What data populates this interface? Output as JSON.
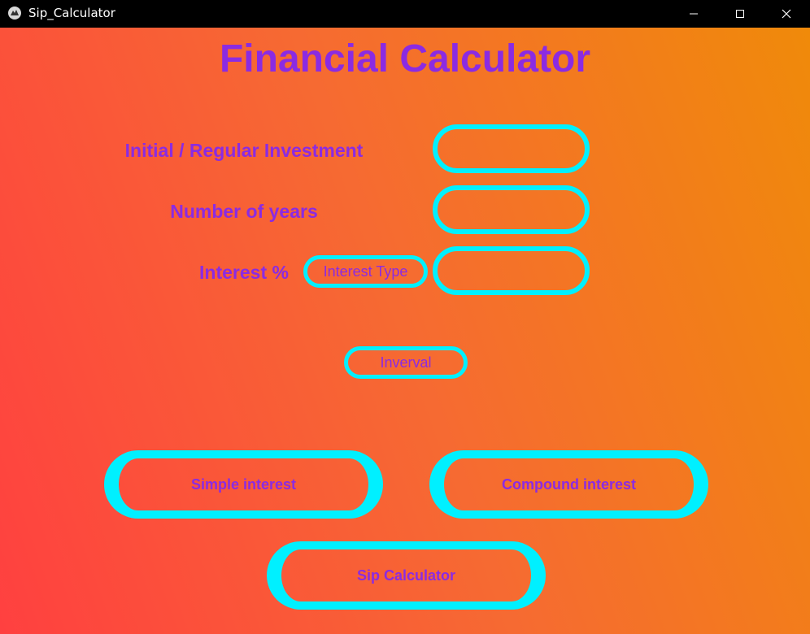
{
  "window": {
    "title": "Sip_Calculator",
    "icon": "kivy-app-icon",
    "controls": [
      "minimize-icon",
      "maximize-icon",
      "close-icon"
    ]
  },
  "app": {
    "title": "Financial Calculator",
    "accent_color": "#8b2be2",
    "border_color": "#00f0ff",
    "background_gradient": [
      "#ff4040",
      "#f66a32",
      "#f08a0a"
    ]
  },
  "form": {
    "investment_label": "Initial / Regular Investment",
    "investment_value": "",
    "years_label": "Number of years",
    "years_value": "",
    "interest_label": "Interest %",
    "interest_value": "",
    "interest_type_label": "Interest Type",
    "interval_label": "Inverval"
  },
  "buttons": {
    "simple_interest": "Simple interest",
    "compound_interest": "Compound interest",
    "sip_calculator": "Sip Calculator"
  }
}
